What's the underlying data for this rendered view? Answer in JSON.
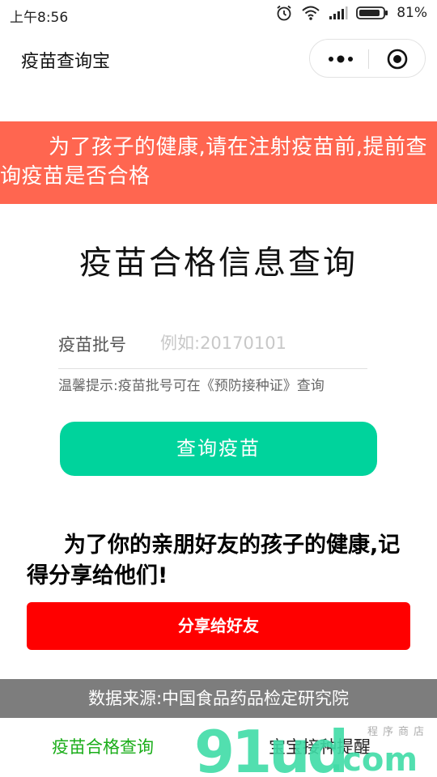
{
  "status_bar": {
    "time": "上午8:56",
    "battery": "81%"
  },
  "nav": {
    "title": "疫苗查询宝"
  },
  "banner": {
    "text": "为了孩子的健康,请在注射疫苗前,提前查询疫苗是否合格"
  },
  "main": {
    "heading": "疫苗合格信息查询",
    "field_label": "疫苗批号",
    "field_placeholder": "例如:20170101",
    "hint": "温馨提示:疫苗批号可在《预防接种证》查询",
    "query_button": "查询疫苗"
  },
  "share": {
    "text": "为了你的亲朋好友的孩子的健康,记得分享给他们!",
    "button": "分享给好友"
  },
  "footer": {
    "source": "数据来源:中国食品药品检定研究院"
  },
  "tabs": [
    {
      "label": "疫苗合格查询"
    },
    {
      "label": "宝宝接种提醒"
    }
  ],
  "watermark": {
    "brand": "91ud",
    "suffix": ".com",
    "tagline": "程序商店"
  },
  "colors": {
    "banner": "#ff6650",
    "query_button": "#00d39c",
    "share_button": "#ff0000",
    "source_bar": "#7d7d7d",
    "tab_active": "#1aad19"
  }
}
